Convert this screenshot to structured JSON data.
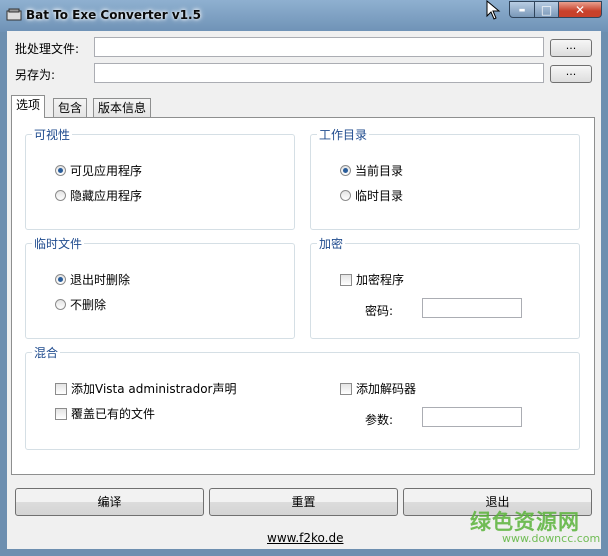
{
  "window": {
    "title": "Bat To Exe Converter v1.5",
    "controls": {
      "minimize": "▬",
      "maximize": "□",
      "close": "✕"
    }
  },
  "fields": {
    "batch_label": "批处理文件:",
    "batch_value": "",
    "saveas_label": "另存为:",
    "saveas_value": "",
    "browse_label": "..."
  },
  "tabs": [
    "选项",
    "包含",
    "版本信息"
  ],
  "groups": {
    "visibility": {
      "title": "可视性",
      "options": [
        "可见应用程序",
        "隐藏应用程序"
      ],
      "selected": 0
    },
    "workdir": {
      "title": "工作目录",
      "options": [
        "当前目录",
        "临时目录"
      ],
      "selected": 0
    },
    "tempfiles": {
      "title": "临时文件",
      "options": [
        "退出时删除",
        "不删除"
      ],
      "selected": 0
    },
    "encrypt": {
      "title": "加密",
      "checkbox": "加密程序",
      "password_label": "密码:",
      "password_value": ""
    },
    "mix": {
      "title": "混合",
      "vista": "添加Vista administrador声明",
      "overwrite": "覆盖已有的文件",
      "decoder": "添加解码器",
      "params_label": "参数:",
      "params_value": ""
    }
  },
  "buttons": {
    "compile": "编译",
    "reset": "重置",
    "exit": "退出"
  },
  "footer_link": "www.f2ko.de",
  "watermark": {
    "text": "绿色资源网",
    "url": "www.downcc.com"
  },
  "colors": {
    "group_title": "#1f4b8e",
    "radio_dot": "#2a5d9a",
    "close_button": "#c8412b"
  }
}
